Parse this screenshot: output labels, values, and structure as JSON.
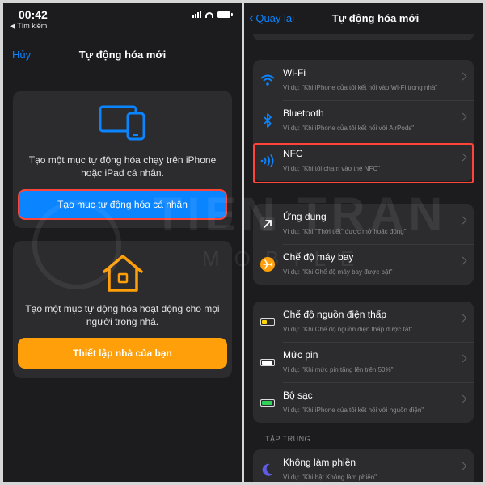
{
  "left": {
    "status": {
      "time": "00:42",
      "back": "◀ Tìm kiếm"
    },
    "nav": {
      "cancel": "Hủy",
      "title": "Tự động hóa mới"
    },
    "personal": {
      "text": "Tạo một mục tự động hóa chạy trên iPhone hoặc iPad cá nhân.",
      "button": "Tạo mục tự động hóa cá nhân",
      "icon": "devices-icon"
    },
    "home": {
      "text": "Tạo một mục tự động hóa hoạt động cho mọi người trong nhà.",
      "button": "Thiết lập nhà của bạn",
      "icon": "home-icon"
    }
  },
  "right": {
    "nav": {
      "back": "Quay lại",
      "title": "Tự động hóa mới"
    },
    "groups": [
      {
        "rows": [
          {
            "title": "Wi-Fi",
            "sub": "Ví dụ: \"Khi iPhone của tôi kết nối vào Wi-Fi trong nhà\"",
            "icon": "wifi-icon"
          },
          {
            "title": "Bluetooth",
            "sub": "Ví dụ: \"Khi iPhone của tôi kết nối với AirPods\"",
            "icon": "bluetooth-icon"
          },
          {
            "title": "NFC",
            "sub": "Ví dụ: \"Khi tôi chạm vào thẻ NFC\"",
            "icon": "nfc-icon"
          }
        ]
      },
      {
        "rows": [
          {
            "title": "Ứng dụng",
            "sub": "Ví dụ: \"Khi \"Thời tiết\" được mở hoặc đóng\"",
            "icon": "app-arrow-icon"
          },
          {
            "title": "Chế độ máy bay",
            "sub": "Ví dụ: \"Khi Chế độ máy bay được bật\"",
            "icon": "airplane-icon"
          }
        ]
      },
      {
        "rows": [
          {
            "title": "Chế độ nguồn điện thấp",
            "sub": "Ví dụ: \"Khi Chế độ nguồn điện thấp được tắt\"",
            "icon": "low-power-battery-icon"
          },
          {
            "title": "Mức pin",
            "sub": "Ví dụ: \"Khi mức pin tăng lên trên 50%\"",
            "icon": "battery-level-icon"
          },
          {
            "title": "Bộ sạc",
            "sub": "Ví dụ: \"Khi iPhone của tôi kết nối với nguồn điện\"",
            "icon": "charger-icon"
          }
        ]
      }
    ],
    "section_focus": "TẬP TRUNG",
    "focus_row": {
      "title": "Không làm phiền",
      "sub": "Ví dụ: \"Khi bật Không làm phiền\"",
      "icon": "moon-icon"
    }
  },
  "watermark": {
    "line1": "TIEN TRAN",
    "line2": "MOBILE"
  },
  "colors": {
    "accent": "#0a84ff",
    "orange": "#ff9f0a",
    "highlight": "#ff453a",
    "panel": "#1c1c1e",
    "card": "#2c2c2e"
  }
}
